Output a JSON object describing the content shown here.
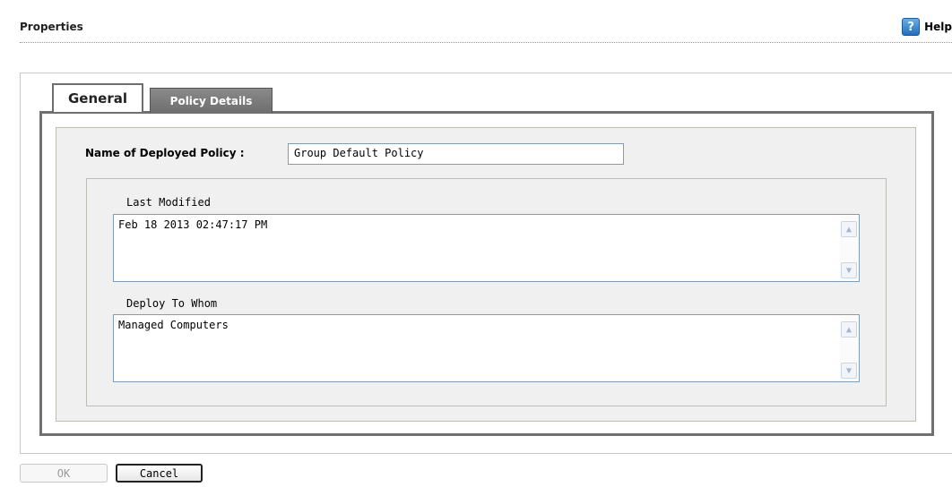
{
  "header": {
    "title": "Properties",
    "help_label": "Help",
    "help_icon": "?"
  },
  "tabs": [
    {
      "label": "General",
      "active": true
    },
    {
      "label": "Policy Details",
      "active": false
    }
  ],
  "general": {
    "name_label": "Name of Deployed Policy :",
    "name_value": "Group Default Policy",
    "last_modified_label": "Last Modified",
    "last_modified_value": "Feb 18 2013 02:47:17 PM",
    "deploy_to_label": "Deploy To Whom",
    "deploy_to_value": "Managed Computers"
  },
  "buttons": {
    "ok": "OK",
    "cancel": "Cancel"
  },
  "icons": {
    "scroll_up": "▲",
    "scroll_down": "▼"
  },
  "colors": {
    "tab_active_border": "#6e6e6e",
    "tab_inactive_bg": "#7a7a7a",
    "panel_bg": "#f0f0f0"
  }
}
